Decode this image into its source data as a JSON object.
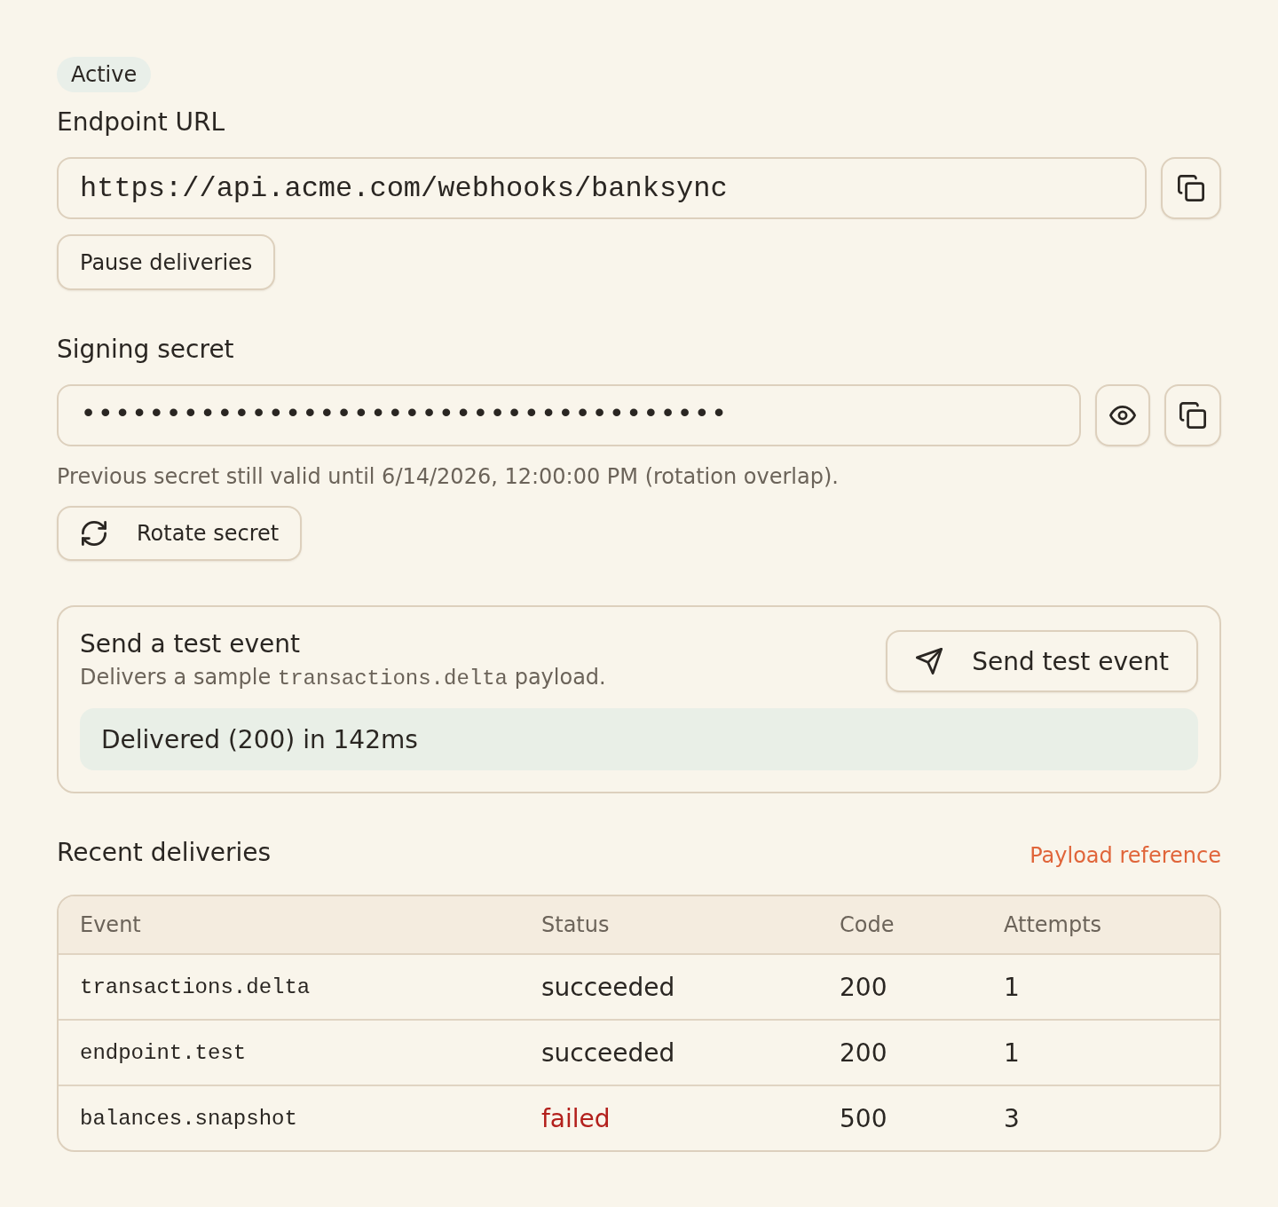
{
  "status_badge": "Active",
  "endpoint": {
    "label": "Endpoint URL",
    "url": "https://api.acme.com/webhooks/banksync",
    "pause_button": "Pause deliveries"
  },
  "signing_secret": {
    "label": "Signing secret",
    "masked_value": "••••••••••••••••••••••••••••••••••••••",
    "note": "Previous secret still valid until 6/14/2026, 12:00:00 PM (rotation overlap).",
    "rotate_button": "Rotate secret"
  },
  "test_event": {
    "title": "Send a test event",
    "description": [
      {
        "kind": "plain",
        "text": "Delivers a sample "
      },
      {
        "kind": "code",
        "text": "transactions.delta"
      },
      {
        "kind": "plain",
        "text": " payload."
      }
    ],
    "send_button": "Send test event",
    "result": "Delivered (200) in 142ms"
  },
  "recent_deliveries": {
    "title": "Recent deliveries",
    "link": "Payload reference",
    "table": {
      "columns": [
        "Event",
        "Status",
        "Code",
        "Attempts"
      ],
      "rows": [
        {
          "event": "transactions.delta",
          "status": "succeeded",
          "failed": false,
          "code": "200",
          "attempts": "1"
        },
        {
          "event": "endpoint.test",
          "status": "succeeded",
          "failed": false,
          "code": "200",
          "attempts": "1"
        },
        {
          "event": "balances.snapshot",
          "status": "failed",
          "failed": true,
          "code": "500",
          "attempts": "3"
        }
      ]
    }
  }
}
